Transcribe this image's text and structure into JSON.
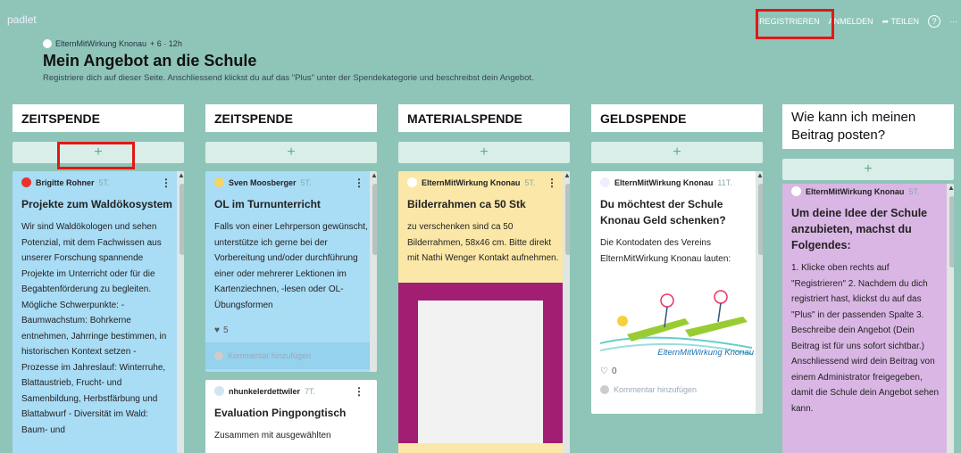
{
  "brand": "padlet",
  "board": {
    "owner": "ElternMitWirkung Knonau",
    "stats": "+ 6 · 12h",
    "title": "Mein Angebot an die Schule",
    "subtitle": "Registriere dich auf dieser Seite. Anschliessend klickst du auf das \"Plus\" unter der Spendekategorie und beschreibst dein Angebot."
  },
  "actions": {
    "register": "REGISTRIEREN",
    "login": "ANMELDEN",
    "share": "TEILEN",
    "help": "?",
    "more": "⋯"
  },
  "plus_label": "+",
  "columns": [
    {
      "title": "ZEITSPENDE",
      "cards": [
        {
          "author": "Brigitte Rohner",
          "ago": "5T.",
          "title": "Projekte zum Waldökosystem",
          "body": "Wir sind Waldökologen und sehen Potenzial, mit dem Fachwissen aus unserer Forschung spannende Projekte im Unterricht oder für die Begabtenförderung zu begleiten. Mögliche Schwerpunkte: - Baumwachstum: Bohrkerne entnehmen, Jahrringe bestimmen, in historischen Kontext setzen - Prozesse im Jahreslauf: Winterruhe, Blattaustrieb, Frucht- und Samenbildung, Herbstfärbung und Blattabwurf - Diversität im Wald: Baum- und"
        }
      ]
    },
    {
      "title": "ZEITSPENDE",
      "cards": [
        {
          "author": "Sven Moosberger",
          "ago": "5T.",
          "title": "OL im Turnunterricht",
          "body": "Falls von einer Lehrperson gewünscht, unterstütze ich gerne bei der Vorbereitung und/oder durchführung einer oder mehrerer Lektionen im Kartenziechnen, -lesen oder OL-Übungsformen",
          "likes": "5",
          "comment": "Kommentar hinzufügen"
        },
        {
          "author": "nhunkelerdettwiler",
          "ago": "7T.",
          "title": "Evaluation Pingpongtisch",
          "body": "Zusammen mit ausgewählten"
        }
      ]
    },
    {
      "title": "MATERIALSPENDE",
      "cards": [
        {
          "author": "ElternMitWirkung Knonau",
          "ago": "5T.",
          "title": "Bilderrahmen ca 50 Stk",
          "body": "zu verschenken sind ca 50 Bilderrahmen, 58x46 cm. Bitte direkt mit Nathi Wenger Kontakt aufnehmen."
        }
      ]
    },
    {
      "title": "GELDSPENDE",
      "cards": [
        {
          "author": "ElternMitWirkung Knonau",
          "ago": "11T.",
          "title": "Du möchtest der Schule Knonau Geld schenken?",
          "body": "Die Kontodaten des Vereins ElternMitWirkung Knonau lauten:",
          "image_caption": "ElternMitWirkung Knonau",
          "likes": "0",
          "comment": "Kommentar hinzufügen"
        }
      ]
    },
    {
      "title": "Wie kann ich meinen Beitrag posten?",
      "cards": [
        {
          "author": "ElternMitWirkung Knonau",
          "ago": "5T.",
          "title": "Um deine Idee der Schule anzubieten, machst du Folgendes:",
          "body": "1. Klicke oben rechts auf \"Registrieren\" 2. Nachdem du dich registriert hast, klickst du auf das \"Plus\" in der passenden Spalte 3. Beschreibe dein Angebot (Dein Beitrag ist für uns sofort sichtbar.) Anschliessend wird dein Beitrag von einem Administrator freigegeben, damit die Schule dein Angebot sehen kann."
        }
      ]
    }
  ],
  "colors": {
    "background": "#8fc5b8",
    "highlight": "#e01818",
    "card_blue": "#a9dcf5",
    "card_yellow": "#fbe8a8",
    "card_purple": "#d9b6e4"
  }
}
